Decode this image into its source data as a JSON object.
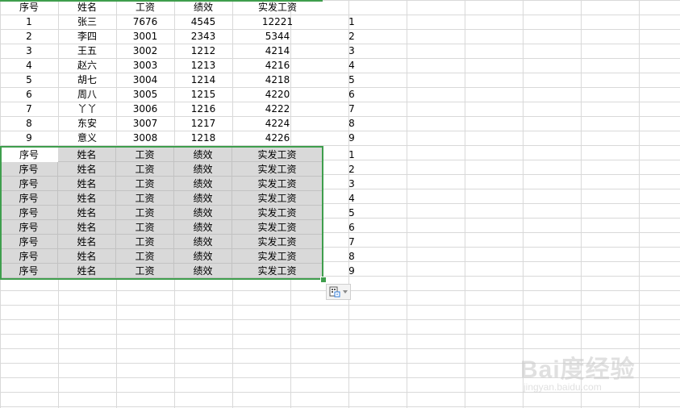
{
  "header": [
    "序号",
    "姓名",
    "工资",
    "绩效",
    "实发工资"
  ],
  "rows": [
    [
      "1",
      "张三",
      "7676",
      "4545",
      "12221",
      "1"
    ],
    [
      "2",
      "李四",
      "3001",
      "2343",
      "5344",
      "2"
    ],
    [
      "3",
      "王五",
      "3002",
      "1212",
      "4214",
      "3"
    ],
    [
      "4",
      "赵六",
      "3003",
      "1213",
      "4216",
      "4"
    ],
    [
      "5",
      "胡七",
      "3004",
      "1214",
      "4218",
      "5"
    ],
    [
      "6",
      "周八",
      "3005",
      "1215",
      "4220",
      "6"
    ],
    [
      "7",
      "丫丫",
      "3006",
      "1216",
      "4222",
      "7"
    ],
    [
      "8",
      "东安",
      "3007",
      "1217",
      "4224",
      "8"
    ],
    [
      "9",
      "意义",
      "3008",
      "1218",
      "4226",
      "9"
    ]
  ],
  "pasted_rows": [
    [
      "序号",
      "姓名",
      "工资",
      "绩效",
      "实发工资",
      "1"
    ],
    [
      "序号",
      "姓名",
      "工资",
      "绩效",
      "实发工资",
      "2"
    ],
    [
      "序号",
      "姓名",
      "工资",
      "绩效",
      "实发工资",
      "3"
    ],
    [
      "序号",
      "姓名",
      "工资",
      "绩效",
      "实发工资",
      "4"
    ],
    [
      "序号",
      "姓名",
      "工资",
      "绩效",
      "实发工资",
      "5"
    ],
    [
      "序号",
      "姓名",
      "工资",
      "绩效",
      "实发工资",
      "6"
    ],
    [
      "序号",
      "姓名",
      "工资",
      "绩效",
      "实发工资",
      "7"
    ],
    [
      "序号",
      "姓名",
      "工资",
      "绩效",
      "实发工资",
      "8"
    ],
    [
      "序号",
      "姓名",
      "工资",
      "绩效",
      "实发工资",
      "9"
    ]
  ],
  "icons": {
    "paste_options": "paste-options-icon",
    "dropdown": "chevron-down-icon"
  },
  "watermark": {
    "text": "Bai度经验",
    "sub": "jingyan.baidu.com"
  },
  "colors": {
    "selection_border": "#3f9e4d",
    "selection_fill": "#d9d9d9",
    "gridline": "#d9d9d9"
  }
}
